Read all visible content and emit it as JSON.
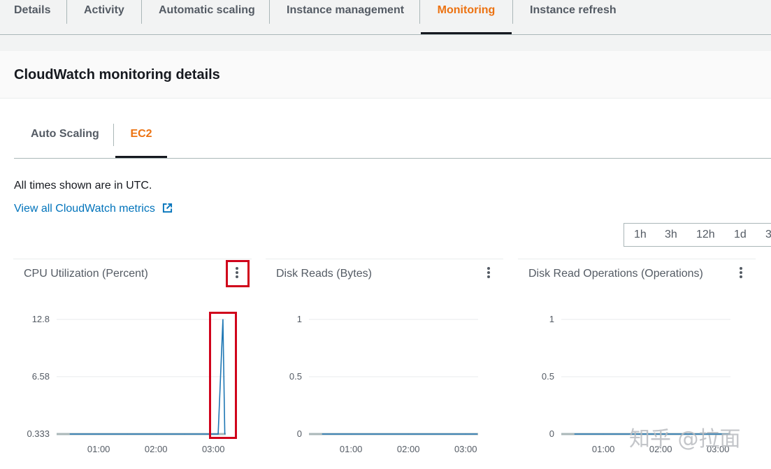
{
  "top_tabs": [
    {
      "label": "Details",
      "active": false
    },
    {
      "label": "Activity",
      "active": false
    },
    {
      "label": "Automatic scaling",
      "active": false
    },
    {
      "label": "Instance management",
      "active": false
    },
    {
      "label": "Monitoring",
      "active": true
    },
    {
      "label": "Instance refresh",
      "active": false
    }
  ],
  "panel": {
    "title": "CloudWatch monitoring details"
  },
  "sub_tabs": [
    {
      "label": "Auto Scaling",
      "active": false
    },
    {
      "label": "EC2",
      "active": true
    }
  ],
  "utc_note": "All times shown are in UTC.",
  "cloudwatch_link": {
    "label": "View all CloudWatch metrics",
    "icon": "external-link-icon"
  },
  "time_range": {
    "options": [
      "1h",
      "3h",
      "12h",
      "1d",
      "3"
    ]
  },
  "colors": {
    "accent": "#ec7211",
    "link": "#0073bb",
    "series": "#1f77b4",
    "highlight": "#d0021b"
  },
  "widgets": [
    {
      "title": "CPU Utilization (Percent)",
      "menu_icon": "kebab-menu-icon"
    },
    {
      "title": "Disk Reads (Bytes)",
      "menu_icon": "kebab-menu-icon"
    },
    {
      "title": "Disk Read Operations (Operations)",
      "menu_icon": "kebab-menu-icon"
    }
  ],
  "chart_data": [
    {
      "type": "line",
      "title": "CPU Utilization (Percent)",
      "x": [
        "00:30",
        "01:00",
        "01:30",
        "02:00",
        "02:30",
        "03:00",
        "03:05",
        "03:10",
        "03:12"
      ],
      "series": [
        {
          "values": [
            0.333,
            0.333,
            0.333,
            0.333,
            0.333,
            0.333,
            0.333,
            12.8,
            0.333
          ]
        }
      ],
      "y_ticks": [
        "12.8",
        "6.58",
        "0.333"
      ],
      "x_ticks": [
        "01:00",
        "02:00",
        "03:00"
      ],
      "ylim": [
        0.333,
        12.8
      ],
      "grid": true
    },
    {
      "type": "line",
      "title": "Disk Reads (Bytes)",
      "x": [
        "00:30",
        "01:00",
        "02:00",
        "03:00",
        "03:12"
      ],
      "series": [
        {
          "values": [
            0,
            0,
            0,
            0,
            0
          ]
        }
      ],
      "y_ticks": [
        "1",
        "0.5",
        "0"
      ],
      "x_ticks": [
        "01:00",
        "02:00",
        "03:00"
      ],
      "ylim": [
        0,
        1
      ],
      "grid": true
    },
    {
      "type": "line",
      "title": "Disk Read Operations (Operations)",
      "x": [
        "00:30",
        "01:00",
        "02:00",
        "03:00",
        "03:12"
      ],
      "series": [
        {
          "values": [
            0,
            0,
            0,
            0,
            0
          ]
        }
      ],
      "y_ticks": [
        "1",
        "0.5",
        "0"
      ],
      "x_ticks": [
        "01:00",
        "02:00",
        "03:00"
      ],
      "ylim": [
        0,
        1
      ],
      "grid": true
    }
  ],
  "watermark": "知乎 @拉面"
}
